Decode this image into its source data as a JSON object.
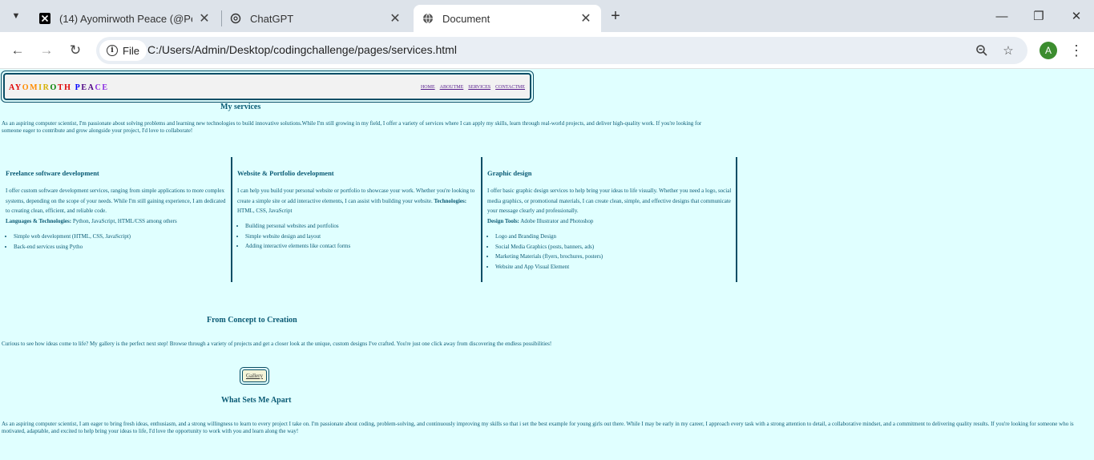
{
  "browser": {
    "tabs": [
      {
        "title": "(14) Ayomirwoth Peace (@Peac",
        "favicon": "x-logo-icon"
      },
      {
        "title": "ChatGPT",
        "favicon": "chatgpt-icon"
      },
      {
        "title": "Document",
        "favicon": "globe-icon",
        "active": true
      }
    ],
    "address": {
      "chip_label": "File",
      "url": "C:/Users/Admin/Desktop/codingchallenge/pages/services.html"
    },
    "profile_initial": "A"
  },
  "header": {
    "logo_letters": [
      "A",
      "Y",
      "O",
      "M",
      "I",
      "R",
      "O",
      "T",
      "H",
      " ",
      "P",
      "E",
      "A",
      "C",
      "E"
    ],
    "logo_colors": [
      "#e00000",
      "#e00000",
      "#ff8c00",
      "#ff8c00",
      "#d6b000",
      "#d6b000",
      "#008000",
      "#e00000",
      "#e00000",
      "#0000ff",
      "#0000ff",
      "#4b0082",
      "#4b0082",
      "#8a2be2",
      "#8a2be2"
    ],
    "nav": [
      "HOME",
      "ABOUTME",
      "SERVICES",
      "CONTACTME"
    ]
  },
  "services": {
    "heading": "My services",
    "intro": "As an aspiring computer scientist, I'm passionate about solving problems and learning new technologies to build innovative solutions.While I'm still growing in my field, I offer a variety of services where I can apply my skills, learn through real-world projects, and deliver high-quality work. If you're looking for someone eager to contribute and grow alongside your project, I'd love to collaborate!",
    "columns": [
      {
        "title": "Freelance software development",
        "desc": "I offer custom software development services, ranging from simple applications to more complex systems, depending on the scope of your needs. While I'm still gaining experience, I am dedicated to creating clean, efficient, and reliable code.",
        "tech_label": "Languages & Technologies:",
        "tech": " Python, JavaScript, HTML/CSS among others",
        "items": [
          "Simple web development (HTML, CSS, JavaScript)",
          "Back-end services using Pytho"
        ]
      },
      {
        "title": "Website & Portfolio development",
        "desc": "I can help you build your personal website or portfolio to showcase your work. Whether you're looking to create a simple site or add interactive elements, I can assist with building your website.",
        "tech_label": "Technologies:",
        "tech": " HTML, CSS, JavaScript",
        "items": [
          "Building personal websites and portfolios",
          "Simple website design and layout",
          "Adding interactive elements like contact forms"
        ]
      },
      {
        "title": "Graphic design",
        "desc": "I offer basic graphic design services to help bring your ideas to life visually. Whether you need a logo, social media graphics, or promotional materials, I can create clean, simple, and effective designs that communicate your message clearly and professionally.",
        "tech_label": "Design Tools:",
        "tech": " Adobe Illustrator and Photoshop",
        "items": [
          "Logo and Branding Design",
          "Social Media Graphics (posts, banners, ads)",
          "Marketing Materials (flyers, brochures, posters)",
          "Website and App Visual Element"
        ]
      }
    ]
  },
  "concept": {
    "heading": "From Concept to Creation",
    "text": "Curious to see how ideas come to life? My gallery is the perfect next step! Browse through a variety of projects and get a closer look at the unique, custom designs I've crafted. You're just one click away from discovering the endless possibilities!",
    "button": "Gallery"
  },
  "apart": {
    "heading": "What Sets Me Apart",
    "text": "As an aspiring computer scientist, I am eager to bring fresh ideas, enthusiasm, and a strong willingness to learn to every project I take on. I'm passionate about coding, problem-solving, and continuously improving my skills so that i set the best example for young girls out there. While I may be early in my career, I approach every task with a strong attention to detail, a collaborative mindset, and a commitment to delivering quality results. If you're looking for someone who is motivated, adaptable, and excited to help bring your ideas to life, I'd love the opportunity to work with you and learn along the way!"
  }
}
